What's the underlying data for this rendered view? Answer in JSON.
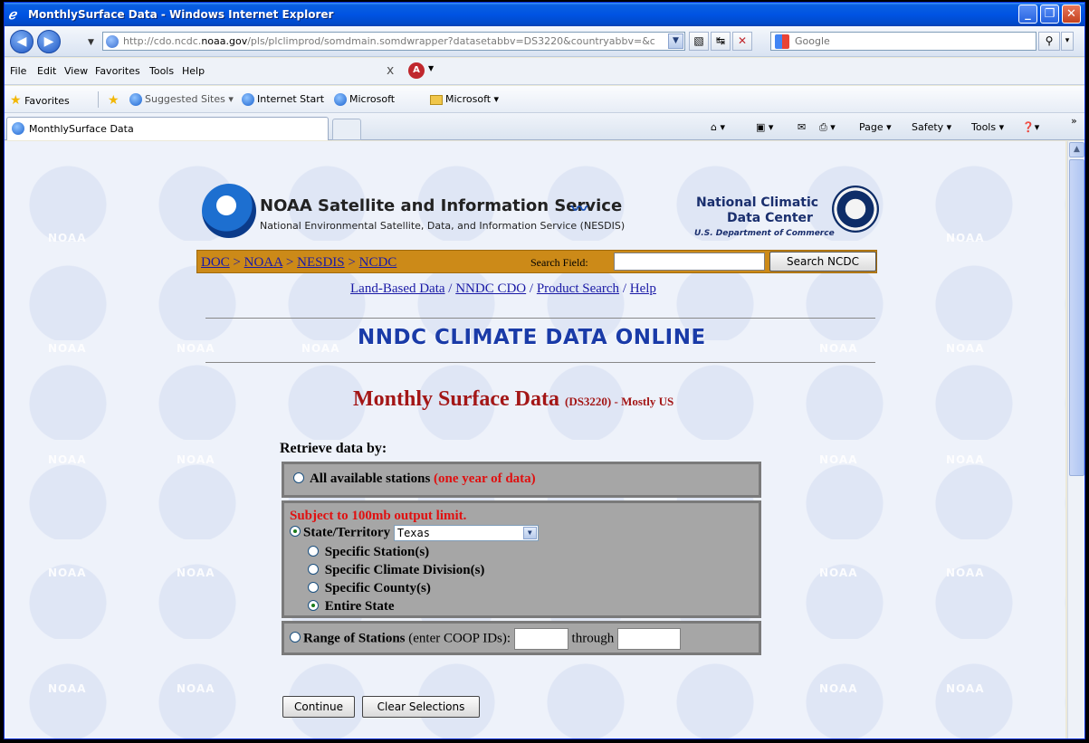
{
  "window": {
    "title": "MonthlySurface Data - Windows Internet Explorer"
  },
  "address": {
    "url_prefix": "http://cdo.ncdc.",
    "url_domain": "noaa.gov",
    "url_rest": "/pls/plclimprod/somdmain.somdwrapper?datasetabbv=DS3220&countryabbv=&c"
  },
  "search": {
    "placeholder": "Google"
  },
  "menu": {
    "file": "File",
    "edit": "Edit",
    "view": "View",
    "favorites": "Favorites",
    "tools": "Tools",
    "help": "Help"
  },
  "favbar": {
    "favorites": "Favorites",
    "suggested": "Suggested Sites ▾",
    "internet_start": "Internet Start",
    "microsoft1": "Microsoft",
    "microsoft2": "Microsoft ▾"
  },
  "tab": {
    "label": "MonthlySurface Data"
  },
  "commands": {
    "page": "Page ▾",
    "safety": "Safety ▾",
    "tools": "Tools ▾",
    "help": "▾"
  },
  "header": {
    "service": "NOAA Satellite and Information Service",
    "subservice": "National Environmental Satellite, Data, and Information Service (NESDIS)",
    "ncdc1": "National Climatic",
    "ncdc2": "Data Center",
    "ncdc3": "U.S. Department of Commerce"
  },
  "crumbs": {
    "doc": "DOC",
    "noaa": "NOAA",
    "nesdis": "NESDIS",
    "ncdc": "NCDC",
    "search_label": "Search Field:",
    "search_button": "Search NCDC"
  },
  "links": {
    "land": "Land-Based Data",
    "nndc": "NNDC CDO",
    "product": "Product Search",
    "help": "Help"
  },
  "banner": "NNDC CLIMATE DATA ONLINE",
  "page": {
    "title": "Monthly Surface Data",
    "code": "(DS3220)",
    "suffix": "- Mostly US"
  },
  "form": {
    "retrieve_label": "Retrieve data by:",
    "all_stations": "All available stations",
    "one_year": "(one year of data)",
    "limit_note": "Subject to 100mb output limit.",
    "state_label": "State/Territory",
    "state_value": "Texas",
    "opt_station": "Specific Station(s)",
    "opt_division": "Specific Climate Division(s)",
    "opt_county": "Specific County(s)",
    "opt_entire": "Entire State",
    "range_label": "Range of Stations",
    "range_note": "(enter COOP IDs):",
    "through": "through",
    "continue": "Continue",
    "clear": "Clear Selections"
  },
  "watermark": "NOAA"
}
